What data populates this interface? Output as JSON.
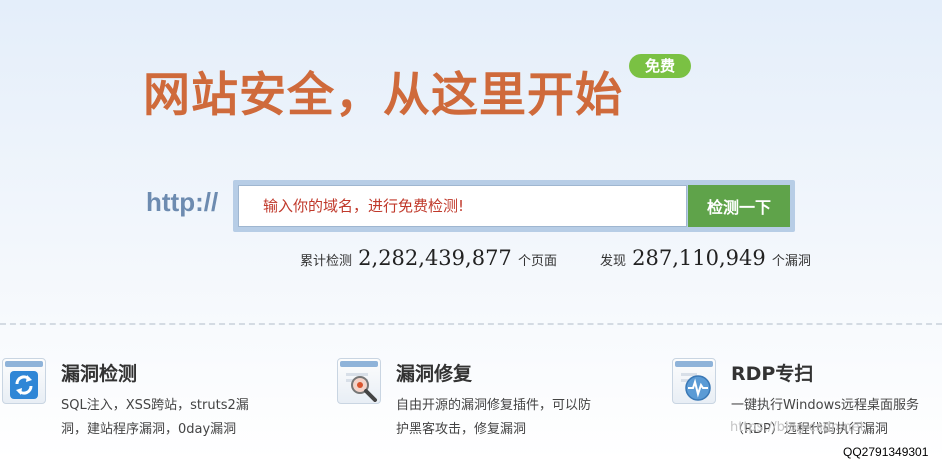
{
  "hero": {
    "title": "网站安全，从这里开始",
    "badge": "免费"
  },
  "search": {
    "prefix": "http://",
    "placeholder": "输入你的域名，进行免费检测!",
    "button_label": "检测一下"
  },
  "stats": [
    {
      "label": "累计检测",
      "value": "2,282,439,877",
      "unit": "个页面"
    },
    {
      "label": "发现",
      "value": "287,110,949",
      "unit": "个漏洞"
    }
  ],
  "features": [
    {
      "title": "漏洞检测",
      "icon": "refresh-icon",
      "description": "SQL注入，XSS跨站，struts2漏洞，建站程序漏洞，0day漏洞"
    },
    {
      "title": "漏洞修复",
      "icon": "magnifier-icon",
      "description": "自由开源的漏洞修复插件，可以防护黑客攻击，修复漏洞"
    },
    {
      "title": "RDP专扫",
      "icon": "heartbeat-icon",
      "description": "一键执行Windows远程桌面服务（RDP）远程代码执行漏洞"
    }
  ],
  "overlay": {
    "watermark": "https://blog.csdn.net",
    "qq": "QQ2791349301"
  },
  "colors": {
    "title": "#cf6a3b",
    "badge": "#7ac143",
    "button": "#5fa34a",
    "http_label": "#6d8bb0",
    "placeholder": "#c0392b"
  }
}
